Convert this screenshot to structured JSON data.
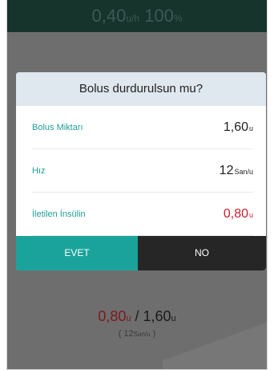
{
  "status_bar": {
    "rate_value": "0,40",
    "rate_unit": "u/h",
    "battery_value": "100",
    "battery_unit": "%"
  },
  "dialog": {
    "title": "Bolus durdurulsun mu?",
    "rows": [
      {
        "label": "Bolus Miktarı",
        "value": "1,60",
        "unit": "u"
      },
      {
        "label": "Hız",
        "value": "12",
        "unit": "San/u"
      },
      {
        "label": "İletilen İnsülin",
        "value": "0,80",
        "unit": "u"
      }
    ],
    "yes_label": "EVET",
    "no_label": "NO"
  },
  "background": {
    "delivered": "0,80",
    "delivered_unit": "u",
    "separator": " / ",
    "total": "1,60",
    "total_unit": "u",
    "rate_open": "( 12",
    "rate_unit": "San/u",
    "rate_close": " )"
  },
  "colors": {
    "accent": "#1aa39a",
    "alert": "#c8202d",
    "header_bg": "#dfe7ef",
    "top_bar": "#16332c"
  }
}
